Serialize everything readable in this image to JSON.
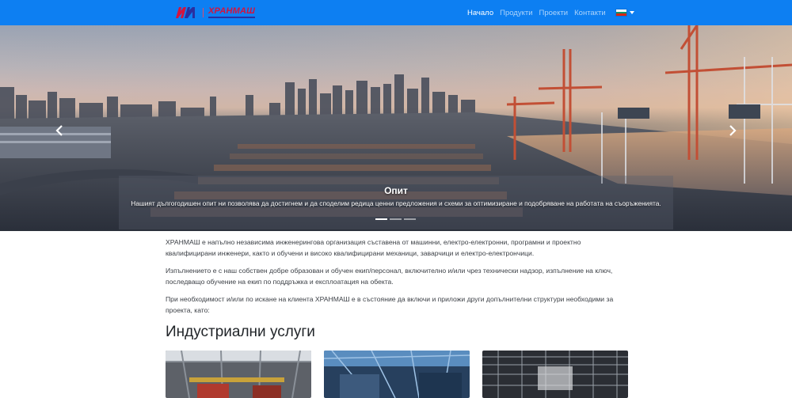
{
  "brand": {
    "logo_mark": "HM",
    "logo_text": "ХРАНМАШ"
  },
  "nav": {
    "items": [
      {
        "label": "Начало",
        "active": true
      },
      {
        "label": "Продукти",
        "active": false
      },
      {
        "label": "Проекти",
        "active": false
      },
      {
        "label": "Контакти",
        "active": false
      }
    ],
    "language_flag": "bulgarian-flag-icon"
  },
  "hero": {
    "caption_title": "Опит",
    "caption_text": "Нашият дългогодишен опит ни позволява да достигнем и да споделим редица ценни предложения и схеми за оптимизиране и подобряване на работата на съоръженията.",
    "slides_count": 3,
    "active_slide": 1
  },
  "about": {
    "paragraphs": [
      "ХРАНМАШ е напълно независима инженерингова организация съставена от машинни, електро-електронни, програмни и проектно квалифицирани инженери, както и обучени и високо квалифицирани механици, заварчици и електро-електрончици.",
      "Изпълнението е с наш собствен добре образован и обучен екип/персонал, включително и/или чрез технически надзор, изпълнение на ключ, последващо обучение на екип по поддръжка и експлоатация на обекта.",
      "При необходимост и/или по искане на клиента ХРАНМАШ е в състояние да включи и приложи други допълнителни структури необходими за проекта, като:"
    ]
  },
  "services": {
    "title": "Индустриални услуги"
  },
  "colors": {
    "navbar": "#0d7ff2",
    "brand_red": "#d4143e",
    "brand_blue": "#2a2fa0",
    "flag": [
      "#ffffff",
      "#00966e",
      "#d62612"
    ]
  }
}
